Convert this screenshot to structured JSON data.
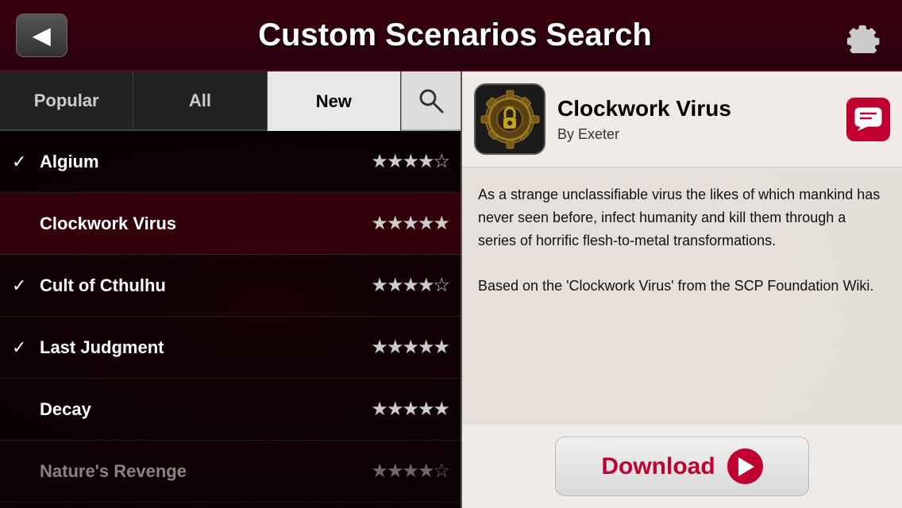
{
  "header": {
    "title": "Custom Scenarios Search",
    "back_label": "◀",
    "gear_label": "⚙"
  },
  "tabs": [
    {
      "label": "Popular",
      "active": false
    },
    {
      "label": "All",
      "active": false
    },
    {
      "label": "New",
      "active": true
    }
  ],
  "search_placeholder": "Search",
  "scenarios": [
    {
      "name": "Algium",
      "stars": 4,
      "checked": true,
      "selected": false
    },
    {
      "name": "Clockwork Virus",
      "stars": 5,
      "checked": false,
      "selected": true
    },
    {
      "name": "Cult of Cthulhu",
      "stars": 4,
      "checked": true,
      "selected": false
    },
    {
      "name": "Last Judgment",
      "stars": 5,
      "checked": true,
      "selected": false
    },
    {
      "name": "Decay",
      "stars": 5,
      "checked": false,
      "selected": false
    },
    {
      "name": "Nature's Revenge",
      "stars": 4,
      "checked": false,
      "selected": false
    }
  ],
  "detail": {
    "title": "Clockwork Virus",
    "author": "By Exeter",
    "description": "As a strange unclassifiable virus the likes of which mankind has never seen before, infect humanity and kill them through a series of horrific flesh-to-metal transformations.\n\nBased on the 'Clockwork Virus' from the SCP Foundation Wiki.",
    "download_label": "Download"
  }
}
